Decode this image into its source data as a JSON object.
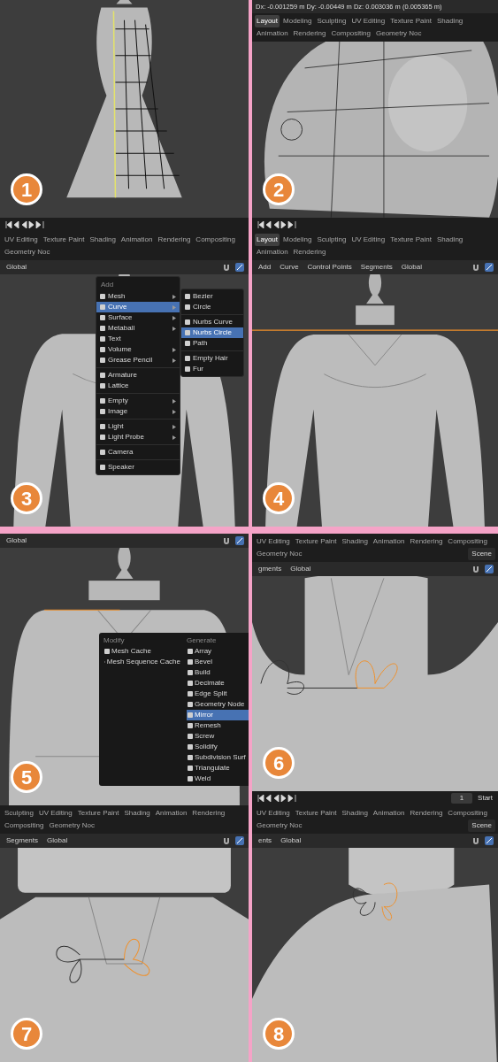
{
  "rows": [
    {
      "panels": [
        {
          "number": "1",
          "kind": "dress",
          "timeline": true
        },
        {
          "number": "2",
          "kind": "bust",
          "tabs": [
            {
              "label": "Layout",
              "selected": true
            },
            {
              "label": "Modeling",
              "selected": false
            },
            {
              "label": "Sculpting",
              "selected": false
            },
            {
              "label": "UV Editing",
              "selected": false
            },
            {
              "label": "Texture Paint",
              "selected": false
            },
            {
              "label": "Shading",
              "selected": false
            },
            {
              "label": "Animation",
              "selected": false
            },
            {
              "label": "Rendering",
              "selected": false
            },
            {
              "label": "Compositing",
              "selected": false
            },
            {
              "label": "Geometry Noc",
              "selected": false
            }
          ],
          "header_text": "Dx: -0.001259 m  Dy: -0.00449 m  Dz: 0.003036 m (0.005365 m)",
          "timeline": true
        }
      ]
    },
    {
      "panels": [
        {
          "number": "3",
          "kind": "torso",
          "tabs": [
            {
              "label": "UV Editing",
              "selected": false
            },
            {
              "label": "Texture Paint",
              "selected": false
            },
            {
              "label": "Shading",
              "selected": false
            },
            {
              "label": "Animation",
              "selected": false
            },
            {
              "label": "Rendering",
              "selected": false
            },
            {
              "label": "Compositing",
              "selected": false
            },
            {
              "label": "Geometry Noc",
              "selected": false
            }
          ],
          "toolbar": [
            "Global"
          ],
          "menu": {
            "kind": "add",
            "title": "Add",
            "items": [
              {
                "kind": "item",
                "label": "Mesh",
                "submenu": true,
                "selected": false
              },
              {
                "kind": "item",
                "label": "Curve",
                "submenu": true,
                "selected": true
              },
              {
                "kind": "item",
                "label": "Surface",
                "submenu": true,
                "selected": false
              },
              {
                "kind": "item",
                "label": "Metaball",
                "submenu": true,
                "selected": false
              },
              {
                "kind": "item",
                "label": "Text",
                "submenu": false,
                "selected": false
              },
              {
                "kind": "item",
                "label": "Volume",
                "submenu": true,
                "selected": false
              },
              {
                "kind": "item",
                "label": "Grease Pencil",
                "submenu": true,
                "selected": false
              },
              {
                "kind": "separator"
              },
              {
                "kind": "item",
                "label": "Armature",
                "submenu": false,
                "selected": false
              },
              {
                "kind": "item",
                "label": "Lattice",
                "submenu": false,
                "selected": false
              },
              {
                "kind": "separator"
              },
              {
                "kind": "item",
                "label": "Empty",
                "submenu": true,
                "selected": false
              },
              {
                "kind": "item",
                "label": "Image",
                "submenu": true,
                "selected": false
              },
              {
                "kind": "separator"
              },
              {
                "kind": "item",
                "label": "Light",
                "submenu": true,
                "selected": false
              },
              {
                "kind": "item",
                "label": "Light Probe",
                "submenu": true,
                "selected": false
              },
              {
                "kind": "separator"
              },
              {
                "kind": "item",
                "label": "Camera",
                "submenu": false,
                "selected": false
              },
              {
                "kind": "separator"
              },
              {
                "kind": "item",
                "label": "Speaker",
                "submenu": false,
                "selected": false
              }
            ],
            "submenu": [
              {
                "kind": "item",
                "label": "Bezier",
                "selected": false
              },
              {
                "kind": "item",
                "label": "Circle",
                "selected": false
              },
              {
                "kind": "separator"
              },
              {
                "kind": "item",
                "label": "Nurbs Curve",
                "selected": false
              },
              {
                "kind": "item",
                "label": "Nurbs Circle",
                "selected": true
              },
              {
                "kind": "item",
                "label": "Path",
                "selected": false
              },
              {
                "kind": "separator"
              },
              {
                "kind": "item",
                "label": "Empty Hair",
                "selected": false
              },
              {
                "kind": "item",
                "label": "Fur",
                "selected": false
              }
            ]
          }
        },
        {
          "number": "4",
          "kind": "torso-line",
          "tabs": [
            {
              "label": "Layout",
              "selected": true
            },
            {
              "label": "Modeling",
              "selected": false
            },
            {
              "label": "Sculpting",
              "selected": false
            },
            {
              "label": "UV Editing",
              "selected": false
            },
            {
              "label": "Texture Paint",
              "selected": false
            },
            {
              "label": "Shading",
              "selected": false
            },
            {
              "label": "Animation",
              "selected": false
            },
            {
              "label": "Rendering",
              "selected": false
            }
          ],
          "toolbar": [
            "Add",
            "Curve",
            "Control Points",
            "Segments",
            "Global"
          ]
        }
      ]
    },
    {
      "panels": [
        {
          "number": "5",
          "kind": "torso-short",
          "toolbar": [
            "Global"
          ],
          "menu": {
            "kind": "modifiers",
            "columns": [
              {
                "title": "Modify",
                "items": [
                  {
                    "label": "Mesh Cache",
                    "selected": false
                  },
                  {
                    "label": "Mesh Sequence Cache",
                    "selected": false
                  }
                ]
              },
              {
                "title": "Generate",
                "items": [
                  {
                    "label": "Array",
                    "selected": false
                  },
                  {
                    "label": "Bevel",
                    "selected": false
                  },
                  {
                    "label": "Build",
                    "selected": false
                  },
                  {
                    "label": "Decimate",
                    "selected": false
                  },
                  {
                    "label": "Edge Split",
                    "selected": false
                  },
                  {
                    "label": "Geometry Node",
                    "selected": false
                  },
                  {
                    "label": "Mirror",
                    "selected": true
                  },
                  {
                    "label": "Remesh",
                    "selected": false
                  },
                  {
                    "label": "Screw",
                    "selected": false
                  },
                  {
                    "label": "Solidify",
                    "selected": false
                  },
                  {
                    "label": "Subdivision Surf",
                    "selected": false
                  },
                  {
                    "label": "Triangulate",
                    "selected": false
                  },
                  {
                    "label": "Weld",
                    "selected": false
                  }
                ]
              }
            ]
          }
        },
        {
          "number": "6",
          "kind": "collar-half",
          "tabs": [
            {
              "label": "UV Editing",
              "selected": false
            },
            {
              "label": "Texture Paint",
              "selected": false
            },
            {
              "label": "Shading",
              "selected": false
            },
            {
              "label": "Animation",
              "selected": false
            },
            {
              "label": "Rendering",
              "selected": false
            },
            {
              "label": "Compositing",
              "selected": false
            },
            {
              "label": "Geometry Noc",
              "selected": false
            }
          ],
          "scene": "Scene",
          "toolbar": [
            "gments",
            "Global"
          ],
          "timeline": true,
          "frame": "1",
          "start_label": "Start"
        }
      ]
    },
    {
      "panels": [
        {
          "number": "7",
          "kind": "collar-full",
          "tabs": [
            {
              "label": "Sculpting",
              "selected": false
            },
            {
              "label": "UV Editing",
              "selected": false
            },
            {
              "label": "Texture Paint",
              "selected": false
            },
            {
              "label": "Shading",
              "selected": false
            },
            {
              "label": "Animation",
              "selected": false
            },
            {
              "label": "Rendering",
              "selected": false
            },
            {
              "label": "Compositing",
              "selected": false
            },
            {
              "label": "Geometry Noc",
              "selected": false
            }
          ],
          "toolbar": [
            "Segments",
            "Global"
          ]
        },
        {
          "number": "8",
          "kind": "collar-side",
          "tabs": [
            {
              "label": "UV Editing",
              "selected": false
            },
            {
              "label": "Texture Paint",
              "selected": false
            },
            {
              "label": "Shading",
              "selected": false
            },
            {
              "label": "Animation",
              "selected": false
            },
            {
              "label": "Rendering",
              "selected": false
            },
            {
              "label": "Compositing",
              "selected": false
            },
            {
              "label": "Geometry Noc",
              "selected": false
            }
          ],
          "scene": "Scene",
          "toolbar": [
            "ents",
            "Global"
          ]
        }
      ]
    }
  ]
}
